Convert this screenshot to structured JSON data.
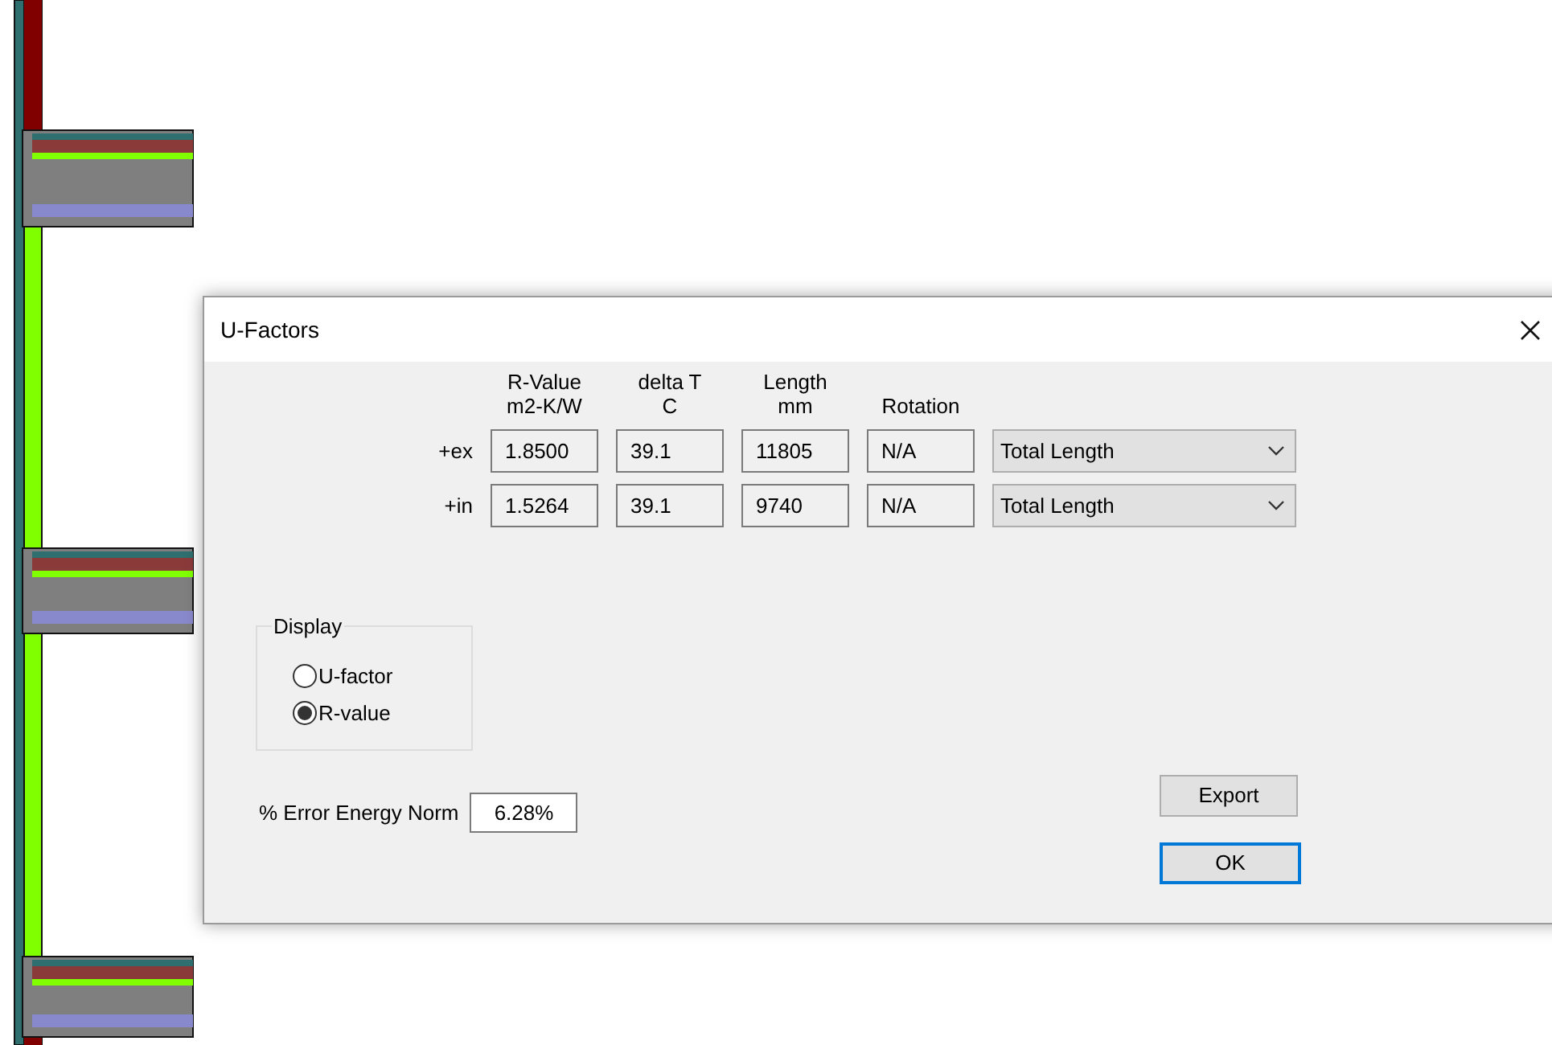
{
  "window": {
    "title": "U-Factors"
  },
  "table": {
    "columns": [
      {
        "lines": [
          "R-Value",
          "m2-K/W"
        ]
      },
      {
        "lines": [
          "delta T",
          "C"
        ]
      },
      {
        "lines": [
          "Length",
          "mm"
        ]
      },
      {
        "lines": [
          "Rotation"
        ]
      }
    ],
    "rows": [
      {
        "label": "+ex",
        "values": [
          "1.8500",
          "39.1",
          "11805",
          "N/A"
        ],
        "dropdown": "Total Length"
      },
      {
        "label": "+in",
        "values": [
          "1.5264",
          "39.1",
          "9740",
          "N/A"
        ],
        "dropdown": "Total Length"
      }
    ]
  },
  "display": {
    "title": "Display",
    "options": [
      {
        "label": "U-factor",
        "selected": false
      },
      {
        "label": "R-value",
        "selected": true
      }
    ]
  },
  "error_norm": {
    "label": "% Error Energy Norm",
    "value": "6.28%"
  },
  "buttons": [
    {
      "label": "Export",
      "default": false
    },
    {
      "label": "OK",
      "default": true
    }
  ]
}
